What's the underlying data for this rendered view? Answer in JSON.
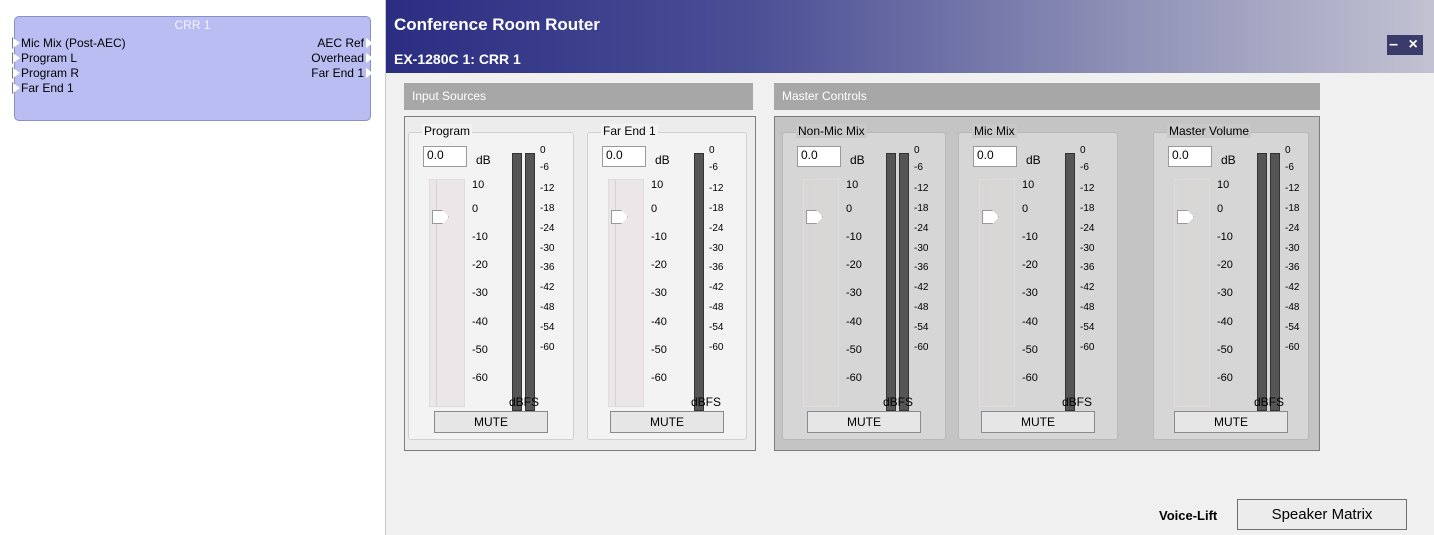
{
  "block": {
    "title": "CRR 1",
    "inputs": [
      "Mic Mix (Post-AEC)",
      "Program L",
      "Program R",
      "Far End 1"
    ],
    "outputs": [
      "AEC Ref",
      "Overhead",
      "Far End 1"
    ]
  },
  "window": {
    "title": "Conference Room Router",
    "subtitle": "EX-1280C 1: CRR 1",
    "controls": "– ×"
  },
  "sections": {
    "input": "Input Sources",
    "master": "Master Controls"
  },
  "channels": [
    {
      "label": "Program",
      "value": "0.0",
      "unit": "dB",
      "mute": "MUTE"
    },
    {
      "label": "Far End 1",
      "value": "0.0",
      "unit": "dB",
      "mute": "MUTE"
    },
    {
      "label": "Non-Mic Mix",
      "value": "0.0",
      "unit": "dB",
      "mute": "MUTE"
    },
    {
      "label": "Mic Mix",
      "value": "0.0",
      "unit": "dB",
      "mute": "MUTE"
    },
    {
      "label": "Master Volume",
      "value": "0.0",
      "unit": "dB",
      "mute": "MUTE"
    }
  ],
  "fader_scale": [
    "10",
    "0",
    "-10",
    "-20",
    "-30",
    "-40",
    "-50",
    "-60"
  ],
  "meter_scale": [
    "0",
    "-6",
    "-12",
    "-18",
    "-24",
    "-30",
    "-36",
    "-42",
    "-48",
    "-54",
    "-60"
  ],
  "meter_unit": "dBFS",
  "footer": {
    "voicelift": "Voice-Lift",
    "matrix_button": "Speaker Matrix"
  }
}
